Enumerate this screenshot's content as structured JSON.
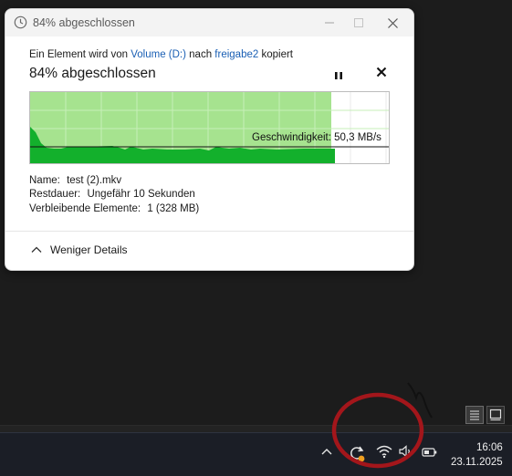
{
  "dialog": {
    "title": "84% abgeschlossen",
    "summary": {
      "prefix": "Ein Element wird von",
      "source": "Volume (D:)",
      "middle": "nach",
      "destination": "freigabe2",
      "suffix": "kopiert"
    },
    "progress_heading": "84% abgeschlossen",
    "progress_percent": 84,
    "speed_label": "Geschwindigkeit: 50,3 MB/s",
    "details": {
      "name_label": "Name:",
      "name_value": "test (2).mkv",
      "rest_label": "Restdauer:",
      "rest_value": "Ungefähr 10 Sekunden",
      "items_label": "Verbleibende Elemente:",
      "items_value": "1 (328 MB)"
    },
    "less_details_label": "Weniger Details"
  },
  "taskbar": {
    "time": "16:06",
    "date": "23.11.2025"
  },
  "colors": {
    "graph_light": "#a6e38f",
    "graph_dark": "#13b02c",
    "link": "#1a5fb4",
    "annotation": "#a3161b"
  }
}
